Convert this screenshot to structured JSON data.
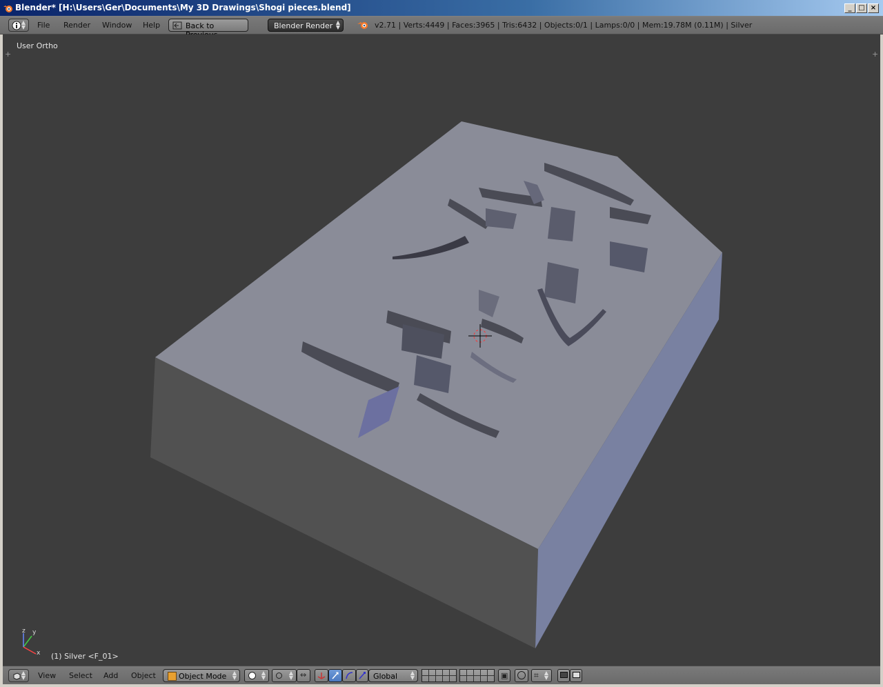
{
  "window": {
    "title": "Blender* [H:\\Users\\Ger\\Documents\\My 3D Drawings\\Shogi pieces.blend]",
    "controls": {
      "minimize": "_",
      "maximize": "□",
      "close": "×"
    }
  },
  "info_header": {
    "menus": [
      "File",
      "Render",
      "Window",
      "Help"
    ],
    "back_button": "Back to Previous",
    "render_engine": "Blender Render",
    "status": "v2.71 | Verts:4449 | Faces:3965 | Tris:6432 | Objects:0/1 | Lamps:0/0 | Mem:19.78M (0.11M) | Silver"
  },
  "viewport": {
    "view_label": "User Ortho",
    "object_label": "(1) Silver <F_01>",
    "axis_labels": {
      "x": "x",
      "y": "y",
      "z": "z"
    }
  },
  "view3d_header": {
    "menus": [
      "View",
      "Select",
      "Add",
      "Object"
    ],
    "mode": "Object Mode",
    "orientation": "Global"
  },
  "colors": {
    "viewport_bg": "#3d3d3d",
    "piece_top": "#8a8c98",
    "piece_front": "#525252",
    "piece_side": "#7b82a3"
  }
}
